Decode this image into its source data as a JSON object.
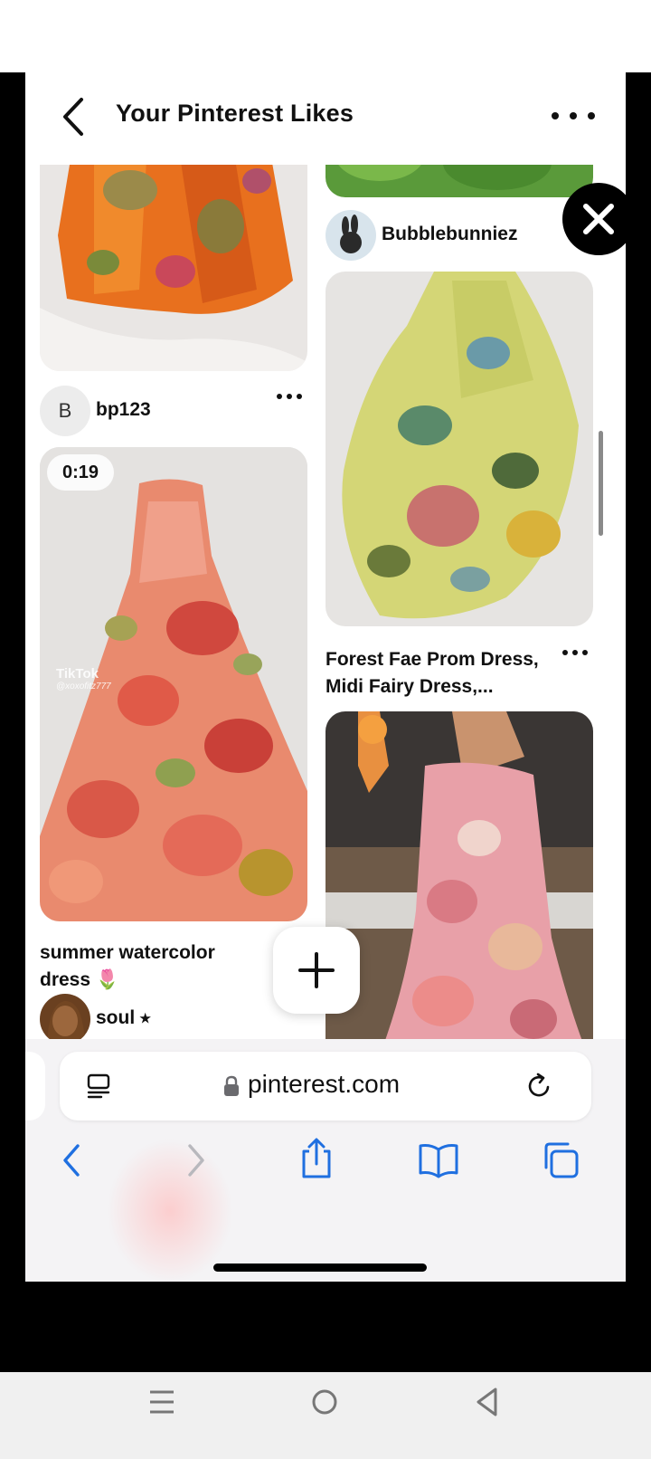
{
  "header": {
    "title": "Your Pinterest Likes"
  },
  "pins": {
    "left": [
      {
        "username": "bp123",
        "avatar_initial": "B"
      },
      {
        "duration": "0:19",
        "watermark": "TikTok",
        "watermark_handle": "@xoxofitz777",
        "title_line1": "summer watercolor",
        "title_line2": "dress 🌷",
        "username": "soul ⭑"
      }
    ],
    "right": [
      {
        "username": "Bubblebunniez"
      },
      {
        "title_line1": "Forest Fae Prom Dress,",
        "title_line2": "Midi Fairy Dress,..."
      }
    ]
  },
  "browser": {
    "url": "pinterest.com"
  },
  "colors": {
    "accent": "#1f6fe0",
    "disabled": "#b8b8bd"
  }
}
